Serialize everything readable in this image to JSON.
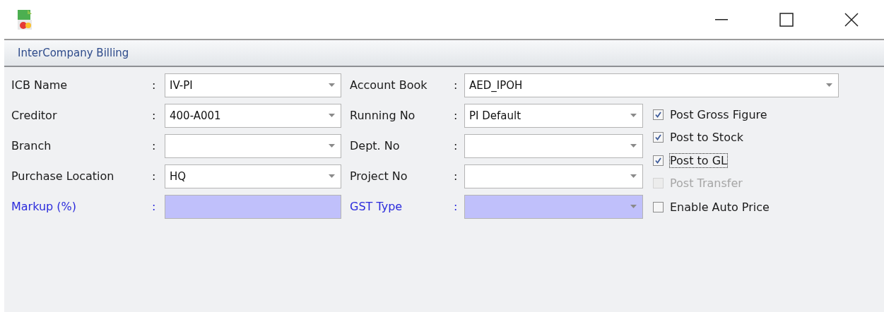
{
  "panel": {
    "title": "InterCompany Billing"
  },
  "left_fields": [
    {
      "label": "ICB Name",
      "colon": ":",
      "value": "IV-PI",
      "highlight": false
    },
    {
      "label": "Creditor",
      "colon": ":",
      "value": "400-A001",
      "highlight": false
    },
    {
      "label": "Branch",
      "colon": ":",
      "highlight": false
    },
    {
      "label": "Purchase Location",
      "colon": ":",
      "value": "HQ",
      "highlight": false
    },
    {
      "label": "Markup (%)",
      "colon": ":",
      "highlight": true,
      "kind": "text"
    }
  ],
  "right_fields": [
    {
      "label": "Account Book",
      "colon": ":",
      "value": "AED_IPOH",
      "highlight": false,
      "wide": true
    },
    {
      "label": "Running No",
      "colon": ":",
      "value": "PI Default",
      "highlight": false
    },
    {
      "label": "Dept. No",
      "colon": ":",
      "highlight": false
    },
    {
      "label": "Project No",
      "colon": ":",
      "highlight": false
    },
    {
      "label": "GST Type",
      "colon": ":",
      "highlight": true
    }
  ],
  "options": [
    {
      "label": "Post Gross Figure",
      "checked": true,
      "disabled": false,
      "focused": false
    },
    {
      "label": "Post to Stock",
      "checked": true,
      "disabled": false,
      "focused": false
    },
    {
      "label": "Post to GL",
      "checked": true,
      "disabled": false,
      "focused": true
    },
    {
      "label": "Post Transfer",
      "checked": false,
      "disabled": true,
      "focused": false
    },
    {
      "label": "Enable Auto Price",
      "checked": false,
      "disabled": false,
      "focused": false
    }
  ]
}
